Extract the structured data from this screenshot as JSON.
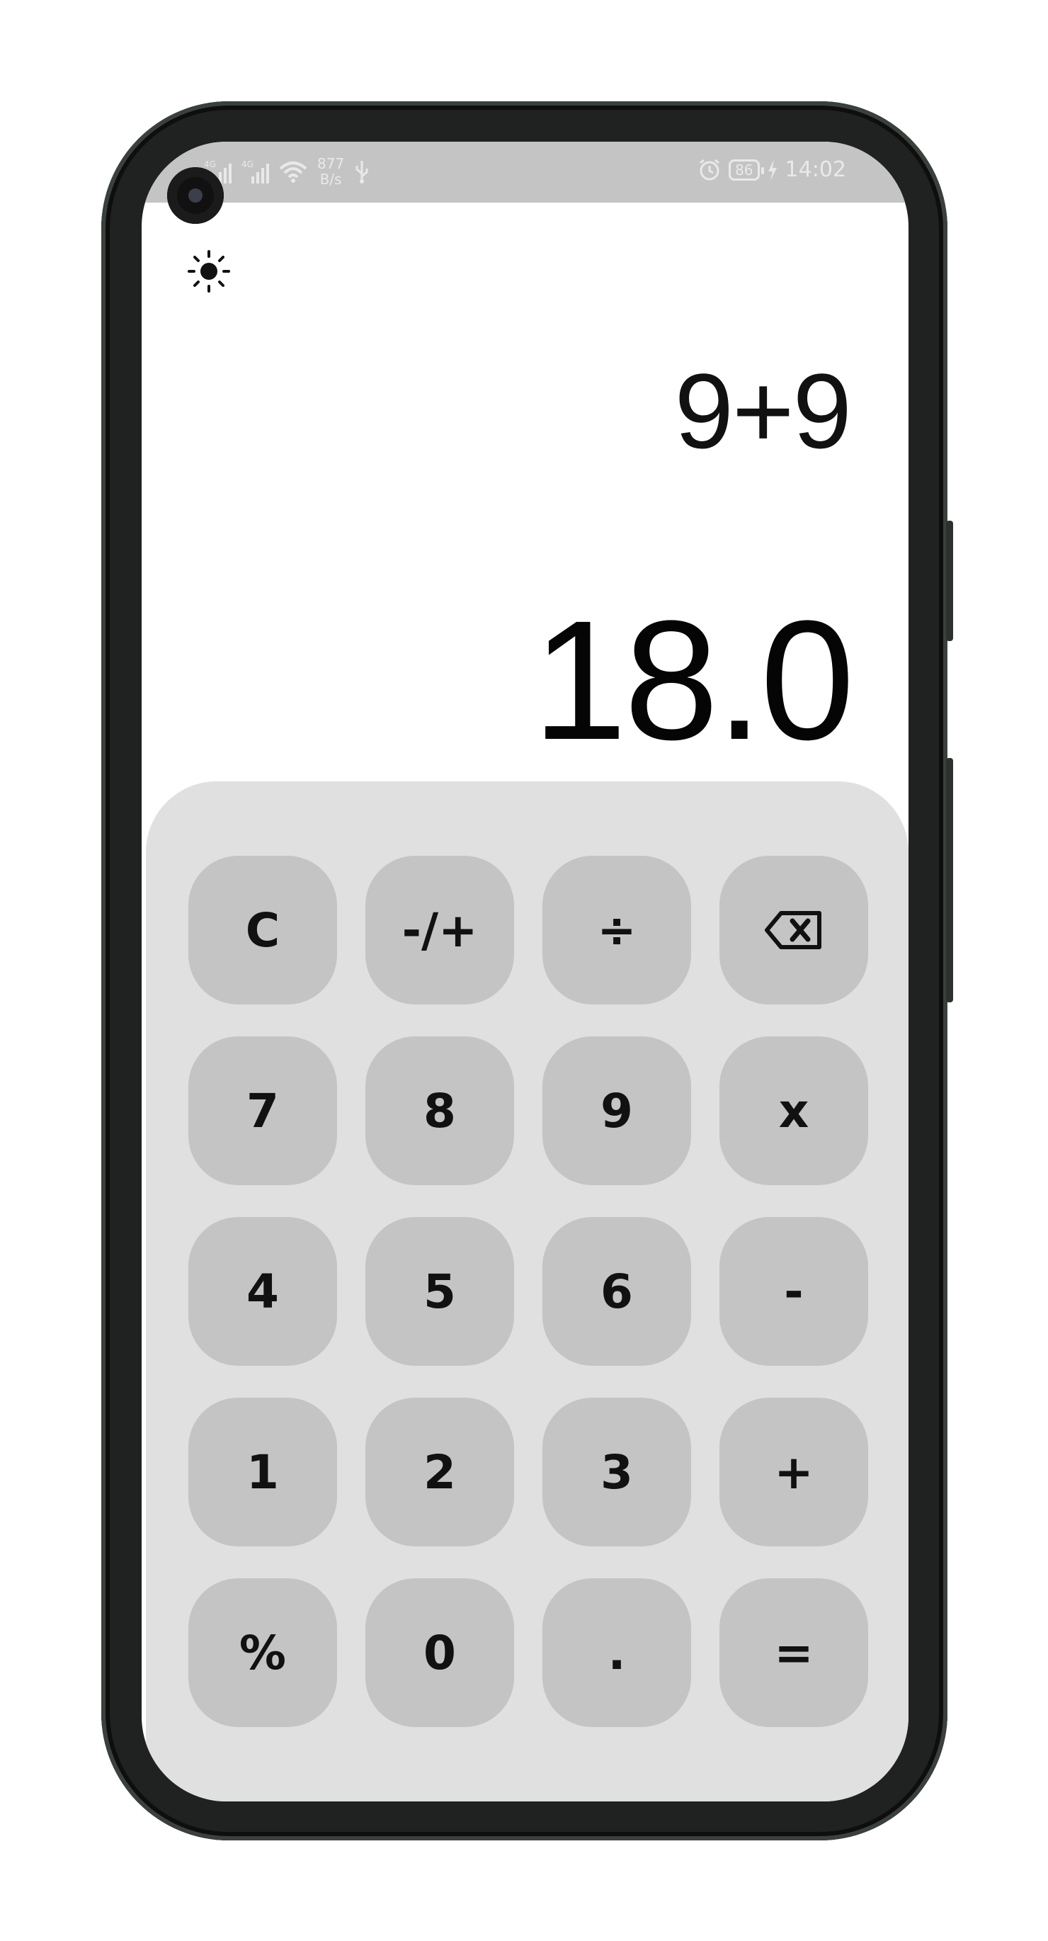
{
  "status_bar": {
    "network_1": "4G",
    "network_2": "4G",
    "speed_value": "877",
    "speed_unit": "B/s",
    "battery": "86",
    "time": "14:02"
  },
  "theme_toggle": {
    "icon": "sun-icon"
  },
  "display": {
    "expression": "9+9",
    "result": "18.0"
  },
  "keypad": {
    "keys": [
      {
        "label": "C",
        "name": "clear-button"
      },
      {
        "label": "-/+",
        "name": "sign-toggle-button"
      },
      {
        "label": "÷",
        "name": "divide-button"
      },
      {
        "label": "",
        "name": "backspace-button",
        "icon": "backspace-icon"
      },
      {
        "label": "7",
        "name": "digit-7-button"
      },
      {
        "label": "8",
        "name": "digit-8-button"
      },
      {
        "label": "9",
        "name": "digit-9-button"
      },
      {
        "label": "x",
        "name": "multiply-button"
      },
      {
        "label": "4",
        "name": "digit-4-button"
      },
      {
        "label": "5",
        "name": "digit-5-button"
      },
      {
        "label": "6",
        "name": "digit-6-button"
      },
      {
        "label": "-",
        "name": "subtract-button"
      },
      {
        "label": "1",
        "name": "digit-1-button"
      },
      {
        "label": "2",
        "name": "digit-2-button"
      },
      {
        "label": "3",
        "name": "digit-3-button"
      },
      {
        "label": "+",
        "name": "add-button"
      },
      {
        "label": "%",
        "name": "percent-button"
      },
      {
        "label": "0",
        "name": "digit-0-button"
      },
      {
        "label": ".",
        "name": "decimal-button"
      },
      {
        "label": "=",
        "name": "equals-button"
      }
    ]
  },
  "colors": {
    "keypad_background": "#e0e0e0",
    "key_background": "#c4c4c4",
    "status_bar": "#c4c4c4"
  }
}
